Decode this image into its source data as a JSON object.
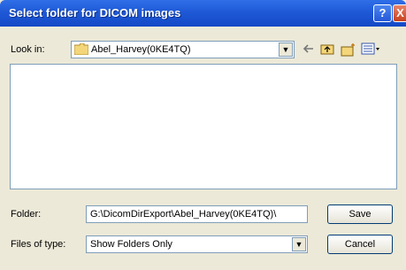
{
  "window": {
    "title": "Select folder for DICOM images",
    "help_label": "?",
    "close_label": "X"
  },
  "lookin": {
    "label": "Look in:",
    "value": "Abel_Harvey(0KE4TQ)"
  },
  "toolbar": {
    "icons": [
      "back-arrow-icon",
      "up-folder-icon",
      "new-folder-icon",
      "view-menu-icon"
    ]
  },
  "folder": {
    "label": "Folder:",
    "value": "G:\\DicomDirExport\\Abel_Harvey(0KE4TQ)\\"
  },
  "files_of_type": {
    "label": "Files of type:",
    "value": "Show Folders Only"
  },
  "buttons": {
    "save": "Save",
    "cancel": "Cancel"
  },
  "colors": {
    "titlebar": "#1f59d6",
    "dialog_bg": "#ece9d8",
    "field_border": "#7f9db9"
  }
}
